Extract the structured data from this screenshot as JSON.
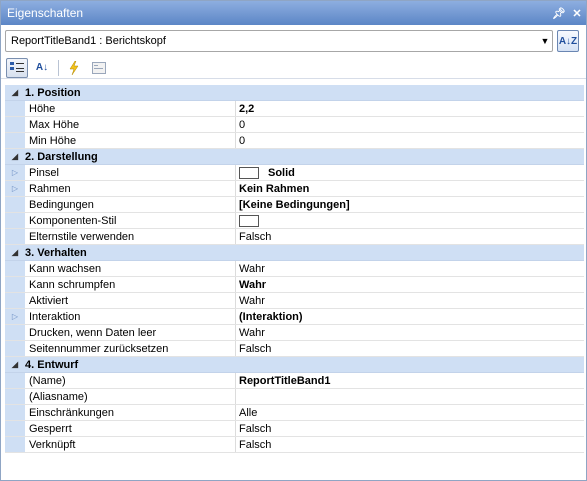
{
  "window": {
    "title": "Eigenschaften",
    "pin_icon": "pin-icon",
    "close_icon": "close-icon"
  },
  "selector": {
    "value": "ReportTitleBand1 : Berichtskopf",
    "sort_button_icon": "alphabetical-sort-icon"
  },
  "toolbar": {
    "buttons": [
      "categorized-view-icon",
      "alphabetical-view-icon",
      "events-icon",
      "property-pages-icon"
    ]
  },
  "categories": [
    {
      "label": "1. Position",
      "rows": [
        {
          "name": "Höhe",
          "value": "2,2",
          "bold": true
        },
        {
          "name": "Max Höhe",
          "value": "0"
        },
        {
          "name": "Min Höhe",
          "value": "0"
        }
      ]
    },
    {
      "label": "2. Darstellung",
      "rows": [
        {
          "name": "Pinsel",
          "value": "Solid",
          "bold": true,
          "expandable": true,
          "swatch": true
        },
        {
          "name": "Rahmen",
          "value": "Kein Rahmen",
          "bold": true,
          "expandable": true
        },
        {
          "name": "Bedingungen",
          "value": "[Keine Bedingungen]",
          "bold": true
        },
        {
          "name": "Komponenten-Stil",
          "value": "",
          "swatch_only": true
        },
        {
          "name": "Elternstile verwenden",
          "value": "Falsch"
        }
      ]
    },
    {
      "label": "3. Verhalten",
      "rows": [
        {
          "name": "Kann wachsen",
          "value": "Wahr"
        },
        {
          "name": "Kann schrumpfen",
          "value": "Wahr",
          "bold": true
        },
        {
          "name": "Aktiviert",
          "value": "Wahr"
        },
        {
          "name": "Interaktion",
          "value": "(Interaktion)",
          "bold": true,
          "expandable": true
        },
        {
          "name": "Drucken, wenn Daten leer",
          "value": "Wahr"
        },
        {
          "name": "Seitennummer zurücksetzen",
          "value": "Falsch"
        }
      ]
    },
    {
      "label": "4. Entwurf",
      "rows": [
        {
          "name": "(Name)",
          "value": "ReportTitleBand1",
          "bold": true
        },
        {
          "name": "(Aliasname)",
          "value": ""
        },
        {
          "name": "Einschränkungen",
          "value": "Alle"
        },
        {
          "name": "Gesperrt",
          "value": "Falsch"
        },
        {
          "name": "Verknüpft",
          "value": "Falsch"
        }
      ]
    }
  ]
}
